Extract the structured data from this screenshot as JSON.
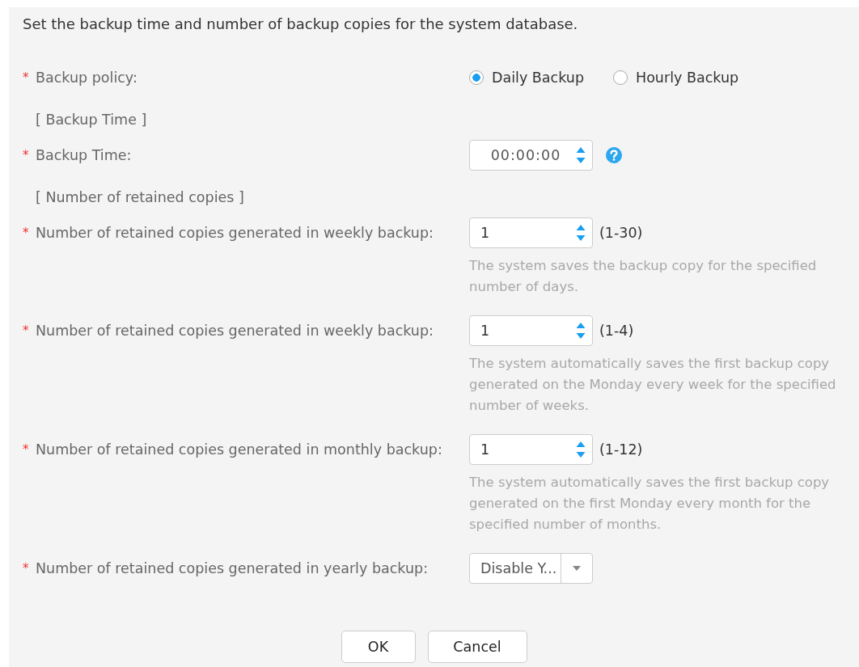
{
  "intro": "Set the backup time and number of backup copies for the system database.",
  "rows": [
    {
      "kind": "radio",
      "required": true,
      "marker": "*",
      "label": "Backup policy:",
      "options": [
        {
          "label": "Daily Backup",
          "selected": true
        },
        {
          "label": "Hourly Backup",
          "selected": false
        }
      ]
    },
    {
      "kind": "section",
      "label": "[ Backup Time ]"
    },
    {
      "kind": "time",
      "required": true,
      "marker": "*",
      "label": "Backup Time:",
      "value": "00:00:00",
      "help": true
    },
    {
      "kind": "section",
      "label": "[ Number of retained copies ]"
    },
    {
      "kind": "number",
      "required": true,
      "marker": "*",
      "label": "Number of retained copies generated in weekly backup:",
      "value": "1",
      "range": "(1-30)",
      "hint": "The system saves the backup copy for the specified number of days."
    },
    {
      "kind": "number",
      "required": true,
      "marker": "*",
      "label": "Number of retained copies generated in weekly backup:",
      "value": "1",
      "range": "(1-4)",
      "hint": "The system automatically saves the first backup copy generated on the Monday every week for the specified number of weeks."
    },
    {
      "kind": "number",
      "required": true,
      "marker": "*",
      "label": "Number of retained copies generated in monthly backup:",
      "value": "1",
      "range": "(1-12)",
      "hint": "The system automatically saves the first backup copy generated on the first Monday every month for the specified number of months."
    },
    {
      "kind": "select",
      "required": true,
      "marker": "*",
      "label": "Number of retained copies generated in yearly backup:",
      "value": "Disable Y..."
    }
  ],
  "buttons": [
    "OK",
    "Cancel"
  ]
}
